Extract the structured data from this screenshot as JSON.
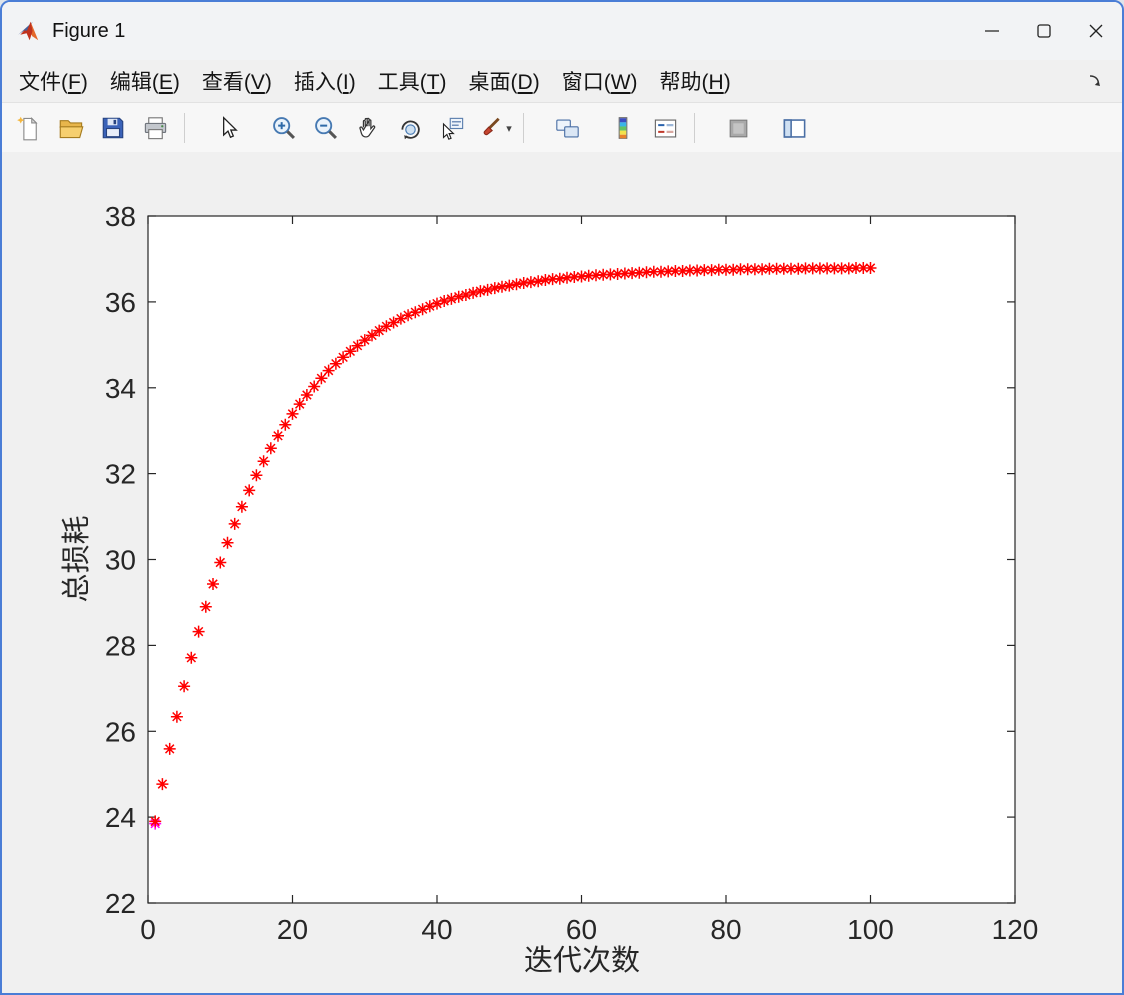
{
  "window": {
    "title": "Figure 1",
    "border_color": "#4a7dd6"
  },
  "titlebar": {
    "controls": [
      "minimize",
      "maximize",
      "close"
    ]
  },
  "menubar": {
    "items": [
      {
        "pre": "文件(",
        "key": "F",
        "post": ")"
      },
      {
        "pre": "编辑(",
        "key": "E",
        "post": ")"
      },
      {
        "pre": "查看(",
        "key": "V",
        "post": ")"
      },
      {
        "pre": "插入(",
        "key": "I",
        "post": ")"
      },
      {
        "pre": "工具(",
        "key": "T",
        "post": ")"
      },
      {
        "pre": "桌面(",
        "key": "D",
        "post": ")"
      },
      {
        "pre": "窗口(",
        "key": "W",
        "post": ")"
      },
      {
        "pre": "帮助(",
        "key": "H",
        "post": ")"
      }
    ],
    "dock_icon": "dock-figure-arrow"
  },
  "toolbar": {
    "buttons": [
      "new-file",
      "open-file",
      "save",
      "print",
      "edit-plot-cursor",
      "zoom-in",
      "zoom-out",
      "pan",
      "rotate-3d",
      "data-cursor",
      "brush",
      "brush-dropdown",
      "link-plot",
      "insert-colorbar",
      "insert-legend",
      "hide-plot-tools",
      "show-plot-tools"
    ]
  },
  "colors": {
    "marker": "#ff0000",
    "start_marker": "#ff00ff",
    "axis": "#262626",
    "axes_background": "#ffffff",
    "figure_background": "#f0f0f0"
  },
  "chart_data": {
    "type": "scatter",
    "title": "",
    "xlabel": "迭代次数",
    "ylabel": "总损耗",
    "xlim": [
      0,
      120
    ],
    "ylim": [
      22,
      38
    ],
    "xticks": [
      0,
      20,
      40,
      60,
      80,
      100,
      120
    ],
    "yticks": [
      22,
      24,
      26,
      28,
      30,
      32,
      34,
      36,
      38
    ],
    "grid": false,
    "legend": "none",
    "marker": "*",
    "series": [
      {
        "name": "initial-point",
        "color": "#ff00ff",
        "x": [
          1
        ],
        "y": [
          23.85
        ]
      },
      {
        "name": "total-loss",
        "color": "#ff0000",
        "x": [
          1,
          2,
          3,
          4,
          5,
          6,
          7,
          8,
          9,
          10,
          11,
          12,
          13,
          14,
          15,
          16,
          17,
          18,
          19,
          20,
          21,
          22,
          23,
          24,
          25,
          26,
          27,
          28,
          29,
          30,
          31,
          32,
          33,
          34,
          35,
          36,
          37,
          38,
          39,
          40,
          41,
          42,
          43,
          44,
          45,
          46,
          47,
          48,
          49,
          50,
          51,
          52,
          53,
          54,
          55,
          56,
          57,
          58,
          59,
          60,
          61,
          62,
          63,
          64,
          65,
          66,
          67,
          68,
          69,
          70,
          71,
          72,
          73,
          74,
          75,
          76,
          77,
          78,
          79,
          80,
          81,
          82,
          83,
          84,
          85,
          86,
          87,
          88,
          89,
          90,
          91,
          92,
          93,
          94,
          95,
          96,
          97,
          98,
          99,
          100
        ],
        "y": [
          23.9,
          24.77,
          25.59,
          26.34,
          27.05,
          27.71,
          28.32,
          28.9,
          29.43,
          29.93,
          30.39,
          30.83,
          31.23,
          31.61,
          31.96,
          32.29,
          32.59,
          32.88,
          33.14,
          33.39,
          33.62,
          33.83,
          34.03,
          34.22,
          34.4,
          34.56,
          34.71,
          34.85,
          34.98,
          35.11,
          35.22,
          35.33,
          35.43,
          35.52,
          35.61,
          35.69,
          35.76,
          35.83,
          35.9,
          35.96,
          36.02,
          36.07,
          36.12,
          36.16,
          36.21,
          36.25,
          36.28,
          36.32,
          36.35,
          36.38,
          36.41,
          36.44,
          36.46,
          36.48,
          36.51,
          36.53,
          36.54,
          36.56,
          36.58,
          36.59,
          36.61,
          36.62,
          36.63,
          36.64,
          36.65,
          36.66,
          36.67,
          36.68,
          36.69,
          36.7,
          36.7,
          36.71,
          36.72,
          36.72,
          36.73,
          36.73,
          36.74,
          36.74,
          36.75,
          36.75,
          36.75,
          36.76,
          36.76,
          36.76,
          36.76,
          36.77,
          36.77,
          36.77,
          36.77,
          36.77,
          36.78,
          36.78,
          36.78,
          36.78,
          36.78,
          36.78,
          36.78,
          36.79,
          36.79,
          36.79
        ]
      }
    ]
  }
}
